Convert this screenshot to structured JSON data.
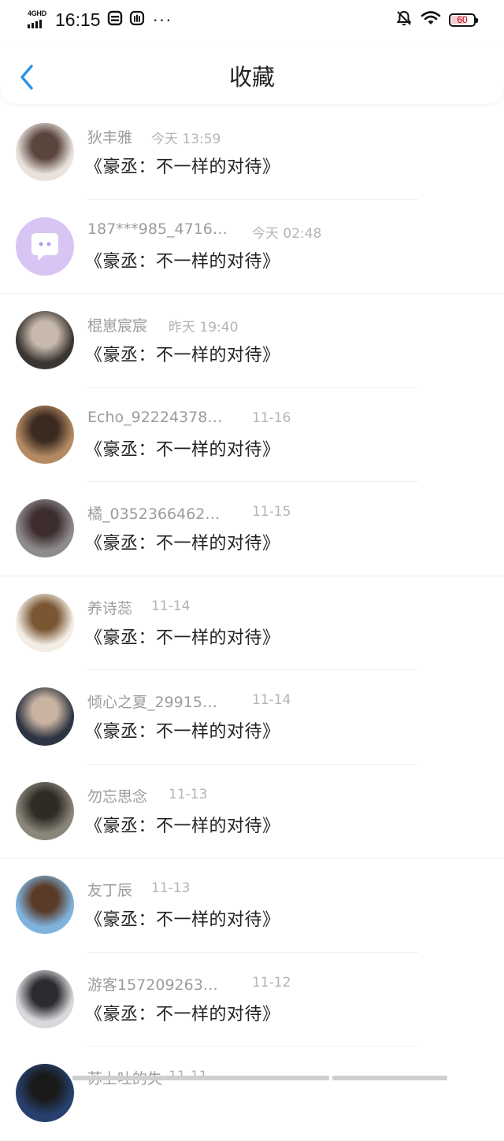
{
  "status_bar": {
    "network": "4GHD",
    "time": "16:15",
    "battery_level": "60",
    "battery_fraction": 0.6,
    "icons": [
      "bars-icon",
      "card-icon",
      "gesture-icon",
      "more-dots-icon",
      "mute-bell-icon",
      "wifi-icon",
      "battery-icon"
    ],
    "dots": "···"
  },
  "header": {
    "title": "收藏",
    "back_icon": "chevron-left-icon",
    "accent": "#2a93e6"
  },
  "items": [
    {
      "name": "狄丰雅",
      "time": "今天 13:59",
      "book": "《豪丞：不一样的对待》",
      "avatar_colors": [
        "#e9e2dc",
        "#5b463e"
      ]
    },
    {
      "name": "187***985_4716…",
      "time": "今天 02:48",
      "book": "《豪丞：不一样的对待》",
      "avatar_colors": [
        "#d9c5f3",
        "#ffffff"
      ]
    },
    {
      "name": "棍崽宸宸",
      "time": "昨天 19:40",
      "book": "《豪丞：不一样的对待》",
      "avatar_colors": [
        "#3b3632",
        "#c8b9ad"
      ]
    },
    {
      "name": "Echo_92224378…",
      "time": "11-16",
      "book": "《豪丞：不一样的对待》",
      "avatar_colors": [
        "#b48a64",
        "#3b2a20"
      ]
    },
    {
      "name": "橘_0352366462…",
      "time": "11-15",
      "book": "《豪丞：不一样的对待》",
      "avatar_colors": [
        "#8e8b8c",
        "#3d2d2f"
      ]
    },
    {
      "name": "养诗蕊",
      "time": "11-14",
      "book": "《豪丞：不一样的对待》",
      "avatar_colors": [
        "#f3ede4",
        "#7a5633"
      ]
    },
    {
      "name": "倾心之夏_29915…",
      "time": "11-14",
      "book": "《豪丞：不一样的对待》",
      "avatar_colors": [
        "#2d3442",
        "#c9b3a1"
      ]
    },
    {
      "name": "勿忘思念",
      "time": "11-13",
      "book": "《豪丞：不一样的对待》",
      "avatar_colors": [
        "#8b867a",
        "#2f2a24"
      ]
    },
    {
      "name": "友丁辰",
      "time": "11-13",
      "book": "《豪丞：不一样的对待》",
      "avatar_colors": [
        "#7fb3de",
        "#5a3b27"
      ]
    },
    {
      "name": "游客157209263…",
      "time": "11-12",
      "book": "《豪丞：不一样的对待》",
      "avatar_colors": [
        "#d9d9dc",
        "#2b2b30"
      ]
    },
    {
      "name": "苏上吐的失",
      "time": "11-11",
      "book": "",
      "avatar_colors": [
        "#27406e",
        "#1a1a1a"
      ]
    }
  ]
}
